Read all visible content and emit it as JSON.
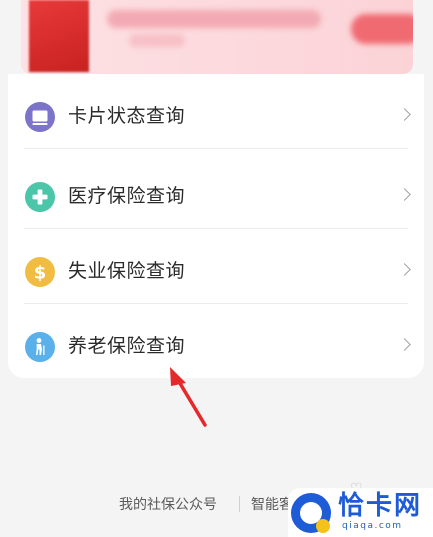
{
  "banner": {
    "cta_label": ""
  },
  "menu": {
    "items": [
      {
        "label": "卡片状态查询",
        "icon": "card-icon",
        "color": "#7b74c8"
      },
      {
        "label": "医疗保险查询",
        "icon": "medical-cross-icon",
        "color": "#4cc6a9"
      },
      {
        "label": "失业保险查询",
        "icon": "dollar-icon",
        "color": "#f0bd42"
      },
      {
        "label": "养老保险查询",
        "icon": "elder-person-icon",
        "color": "#5ab0ea"
      }
    ]
  },
  "footer": {
    "link1": "我的社保公众号",
    "link2": "智能客服"
  },
  "watermark": {
    "brand": "恰卡网",
    "domain": "qiaqa.com"
  },
  "colors": {
    "annotation_arrow": "#e5282a",
    "accent": "#1e5bd6"
  }
}
